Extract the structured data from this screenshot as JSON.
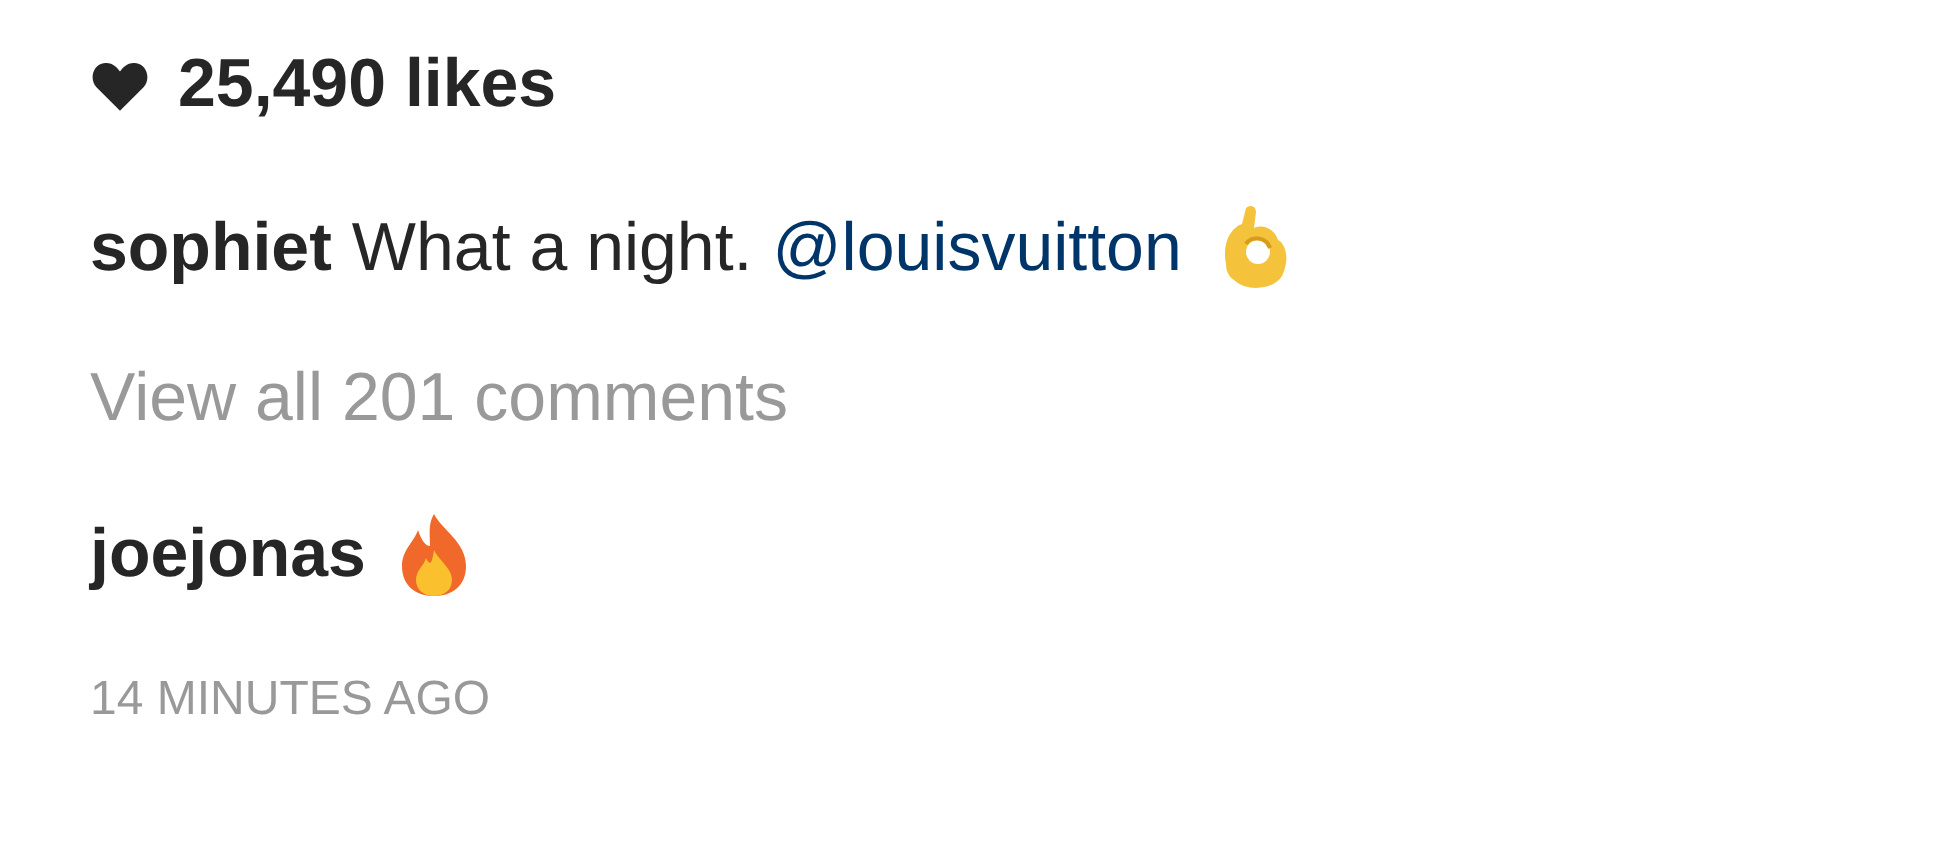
{
  "likes": {
    "count": "25,490 likes"
  },
  "caption": {
    "username": "sophiet",
    "text": "What a night.",
    "mention": "@louisvuitton"
  },
  "view_comments": "View all 201 comments",
  "comments": [
    {
      "username": "joejonas"
    }
  ],
  "timestamp": "14 MINUTES AGO"
}
